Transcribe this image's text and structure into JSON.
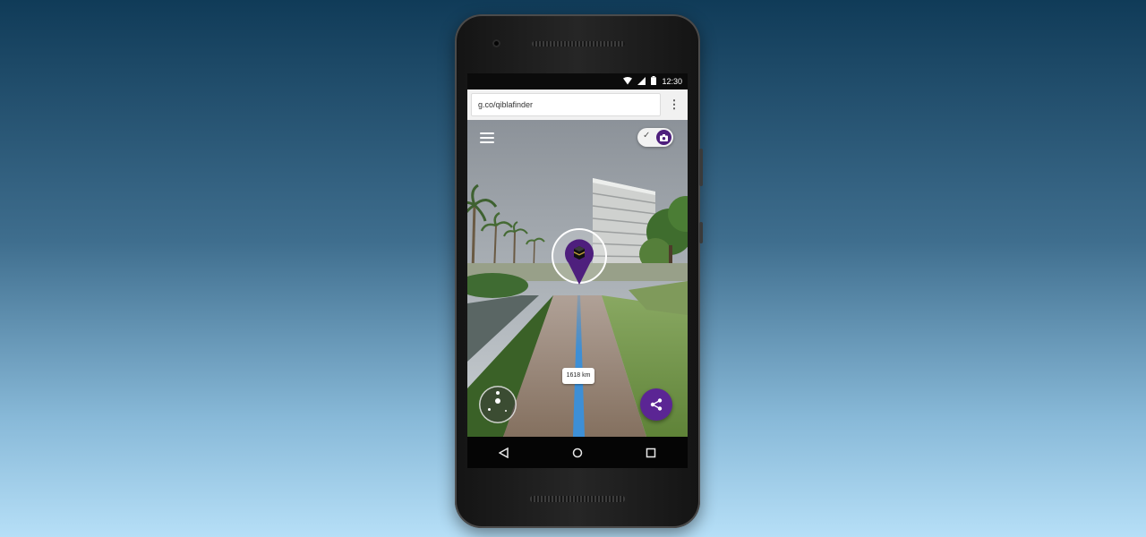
{
  "status_bar": {
    "time": "12:30"
  },
  "browser": {
    "url": "g.co/qiblafinder",
    "menu_icon": "more-vert-icon"
  },
  "app": {
    "menu_icon": "hamburger-menu-icon",
    "camera_toggle": {
      "check_icon": "check-icon",
      "knob_icon": "camera-icon"
    },
    "qibla_marker_icon": "kaaba-icon",
    "distance_label": "1618 km",
    "share_icon": "share-icon",
    "compass_icon": "compass-icon"
  },
  "colors": {
    "accent": "#5b2594",
    "path_line": "#3d8fd6"
  },
  "android_nav": {
    "back": "back-icon",
    "home": "home-icon",
    "recents": "recents-icon"
  }
}
